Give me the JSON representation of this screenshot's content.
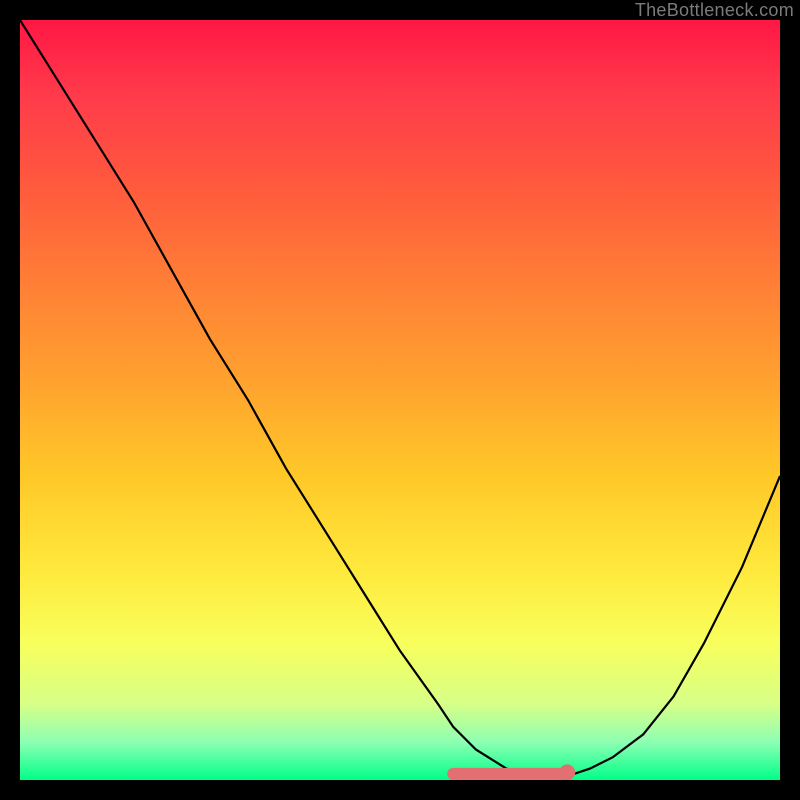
{
  "watermark": "TheBottleneck.com",
  "chart_data": {
    "type": "line",
    "title": "",
    "xlabel": "",
    "ylabel": "",
    "xlim": [
      0,
      100
    ],
    "ylim": [
      0,
      100
    ],
    "series": [
      {
        "name": "curve",
        "x": [
          0,
          5,
          10,
          15,
          20,
          25,
          30,
          35,
          40,
          45,
          50,
          55,
          57,
          60,
          64,
          68,
          72,
          75,
          78,
          82,
          86,
          90,
          95,
          100
        ],
        "values": [
          100,
          92,
          84,
          76,
          67,
          58,
          50,
          41,
          33,
          25,
          17,
          10,
          7,
          4,
          1.5,
          0.5,
          0.5,
          1.5,
          3,
          6,
          11,
          18,
          28,
          40
        ]
      }
    ],
    "flat_marker": {
      "x_start": 57,
      "x_end": 72,
      "y": 0.8,
      "color": "#e27070"
    },
    "dot_marker": {
      "x": 72,
      "y": 1.0,
      "color": "#e27070"
    },
    "gradient_stops": [
      {
        "pos": 0.0,
        "color": "#ff1744"
      },
      {
        "pos": 0.1,
        "color": "#ff3b4b"
      },
      {
        "pos": 0.22,
        "color": "#ff5a3d"
      },
      {
        "pos": 0.35,
        "color": "#ff8036"
      },
      {
        "pos": 0.48,
        "color": "#ffa32e"
      },
      {
        "pos": 0.6,
        "color": "#ffc828"
      },
      {
        "pos": 0.72,
        "color": "#ffe83c"
      },
      {
        "pos": 0.82,
        "color": "#f8ff5c"
      },
      {
        "pos": 0.9,
        "color": "#d7ff87"
      },
      {
        "pos": 0.95,
        "color": "#8dffb3"
      },
      {
        "pos": 1.0,
        "color": "#00ff88"
      }
    ]
  }
}
